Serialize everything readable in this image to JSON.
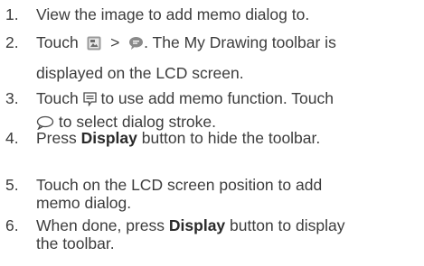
{
  "steps": [
    {
      "number": "1.",
      "line1": "View the image to add memo dialog to."
    },
    {
      "number": "2.",
      "prefix": "Touch",
      "separator": ">",
      "after_icons": ". The My Drawing toolbar is",
      "line2": "displayed on the LCD screen.",
      "icon_1": "gallery-menu-icon",
      "icon_2": "speech-bubble-icon"
    },
    {
      "number": "3.",
      "prefix": "Touch",
      "after_icon": "to use add memo function. Touch",
      "line2_suffix": "to select dialog stroke.",
      "icon_1": "memo-icon",
      "icon_2": "dialog-stroke-icon"
    },
    {
      "number": "4.",
      "before_bold": "Press",
      "bold": "Display",
      "after_bold": "button to hide the toolbar."
    },
    {
      "number": "5.",
      "line1": "Touch on the LCD screen position to add",
      "line2": "memo dialog."
    },
    {
      "number": "6.",
      "before_bold": "When done, press",
      "bold": "Display",
      "after_bold": "button to display",
      "line2": "the toolbar."
    }
  ]
}
